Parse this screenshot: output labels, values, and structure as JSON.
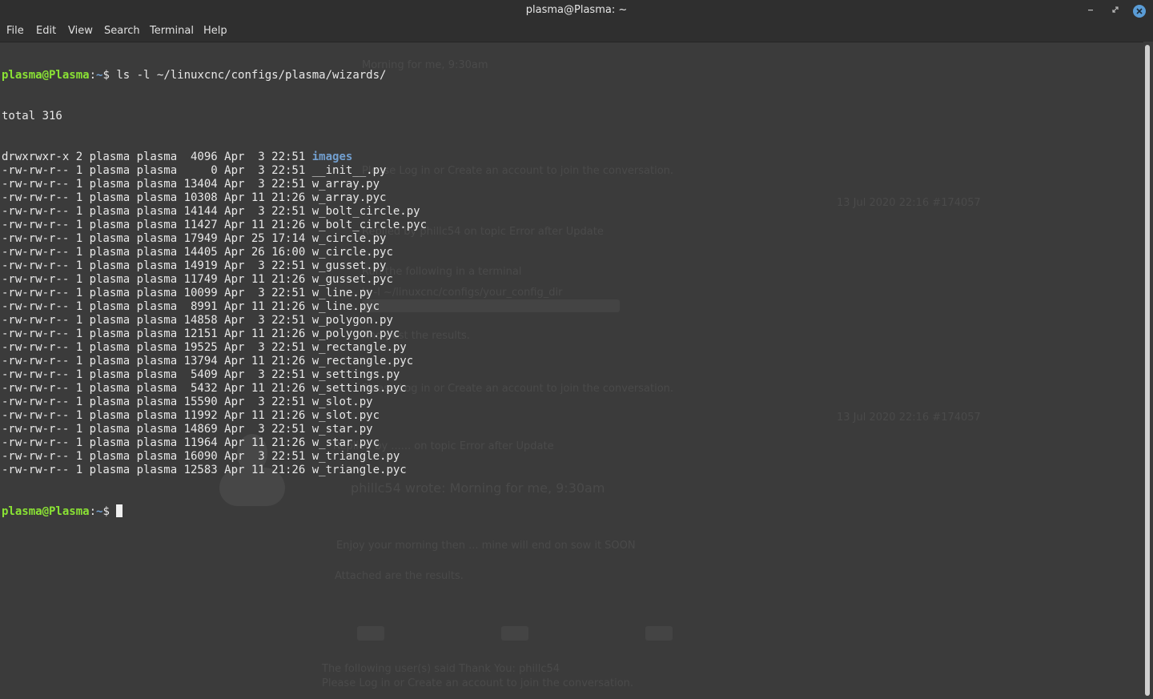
{
  "window": {
    "title": "plasma@Plasma: ~"
  },
  "menubar": {
    "items": [
      "File",
      "Edit",
      "View",
      "Search",
      "Terminal",
      "Help"
    ]
  },
  "terminal": {
    "prompt_user_host": "plasma@Plasma",
    "prompt_sep": ":",
    "prompt_path": "~",
    "prompt_symbol": "$ ",
    "command": "ls -l ~/linuxcnc/configs/plasma/wizards/",
    "total_line": "total 316",
    "entries": [
      {
        "meta": "drwxrwxr-x 2 plasma plasma  4096 Apr  3 22:51 ",
        "name": "images",
        "is_dir": true
      },
      {
        "meta": "-rw-rw-r-- 1 plasma plasma     0 Apr  3 22:51 ",
        "name": "__init__.py",
        "is_dir": false
      },
      {
        "meta": "-rw-rw-r-- 1 plasma plasma 13404 Apr  3 22:51 ",
        "name": "w_array.py",
        "is_dir": false
      },
      {
        "meta": "-rw-rw-r-- 1 plasma plasma 10308 Apr 11 21:26 ",
        "name": "w_array.pyc",
        "is_dir": false
      },
      {
        "meta": "-rw-rw-r-- 1 plasma plasma 14144 Apr  3 22:51 ",
        "name": "w_bolt_circle.py",
        "is_dir": false
      },
      {
        "meta": "-rw-rw-r-- 1 plasma plasma 11427 Apr 11 21:26 ",
        "name": "w_bolt_circle.pyc",
        "is_dir": false
      },
      {
        "meta": "-rw-rw-r-- 1 plasma plasma 17949 Apr 25 17:14 ",
        "name": "w_circle.py",
        "is_dir": false
      },
      {
        "meta": "-rw-rw-r-- 1 plasma plasma 14405 Apr 26 16:00 ",
        "name": "w_circle.pyc",
        "is_dir": false
      },
      {
        "meta": "-rw-rw-r-- 1 plasma plasma 14919 Apr  3 22:51 ",
        "name": "w_gusset.py",
        "is_dir": false
      },
      {
        "meta": "-rw-rw-r-- 1 plasma plasma 11749 Apr 11 21:26 ",
        "name": "w_gusset.pyc",
        "is_dir": false
      },
      {
        "meta": "-rw-rw-r-- 1 plasma plasma 10099 Apr  3 22:51 ",
        "name": "w_line.py",
        "is_dir": false
      },
      {
        "meta": "-rw-rw-r-- 1 plasma plasma  8991 Apr 11 21:26 ",
        "name": "w_line.pyc",
        "is_dir": false
      },
      {
        "meta": "-rw-rw-r-- 1 plasma plasma 14858 Apr  3 22:51 ",
        "name": "w_polygon.py",
        "is_dir": false
      },
      {
        "meta": "-rw-rw-r-- 1 plasma plasma 12151 Apr 11 21:26 ",
        "name": "w_polygon.pyc",
        "is_dir": false
      },
      {
        "meta": "-rw-rw-r-- 1 plasma plasma 19525 Apr  3 22:51 ",
        "name": "w_rectangle.py",
        "is_dir": false
      },
      {
        "meta": "-rw-rw-r-- 1 plasma plasma 13794 Apr 11 21:26 ",
        "name": "w_rectangle.pyc",
        "is_dir": false
      },
      {
        "meta": "-rw-rw-r-- 1 plasma plasma  5409 Apr  3 22:51 ",
        "name": "w_settings.py",
        "is_dir": false
      },
      {
        "meta": "-rw-rw-r-- 1 plasma plasma  5432 Apr 11 21:26 ",
        "name": "w_settings.pyc",
        "is_dir": false
      },
      {
        "meta": "-rw-rw-r-- 1 plasma plasma 15590 Apr  3 22:51 ",
        "name": "w_slot.py",
        "is_dir": false
      },
      {
        "meta": "-rw-rw-r-- 1 plasma plasma 11992 Apr 11 21:26 ",
        "name": "w_slot.pyc",
        "is_dir": false
      },
      {
        "meta": "-rw-rw-r-- 1 plasma plasma 14869 Apr  3 22:51 ",
        "name": "w_star.py",
        "is_dir": false
      },
      {
        "meta": "-rw-rw-r-- 1 plasma plasma 11964 Apr 11 21:26 ",
        "name": "w_star.pyc",
        "is_dir": false
      },
      {
        "meta": "-rw-rw-r-- 1 plasma plasma 16090 Apr  3 22:51 ",
        "name": "w_triangle.py",
        "is_dir": false
      },
      {
        "meta": "-rw-rw-r-- 1 plasma plasma 12583 Apr 11 21:26 ",
        "name": "w_triangle.pyc",
        "is_dir": false
      }
    ]
  },
  "background_page": {
    "reply_heading": "Replied by",
    "reply_topic": "on topic",
    "reply_subject": "Error after Update",
    "quote": "phillc54 wrote: Morning for me, 9:30am",
    "enjoy_line": "Enjoy your morning then ... ",
    "attached": "Attached are the results.",
    "thanks": "The following user(s) said Thank You: phillc54",
    "login_prompt": "Please Log in or Create an account to join the conversation.",
    "timestamp": "13 Jul 2020 22:16 #174057"
  },
  "colors": {
    "window_bg": "#3b3b3b",
    "titlebar_bg": "#2f2f2f",
    "prompt_green": "#8ae234",
    "directory_blue": "#729fcf",
    "close_button_blue": "#5a9cd6"
  }
}
